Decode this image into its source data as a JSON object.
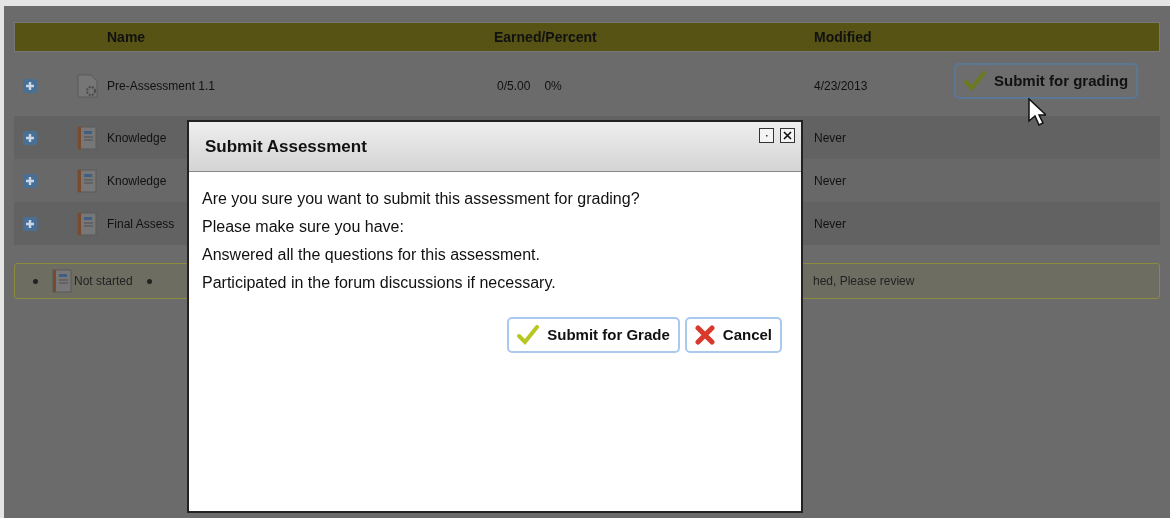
{
  "table": {
    "columns": [
      "Name",
      "Earned/Percent",
      "Modified"
    ],
    "rows": [
      {
        "kind": "settings-doc",
        "name": "Pre-Assessment 1.1",
        "earned": "0/5.00",
        "percent": "0%",
        "modified": "4/23/2013",
        "action": "Submit for grading"
      },
      {
        "kind": "notebook",
        "name": "Knowledge",
        "modified": "Never"
      },
      {
        "kind": "notebook",
        "name": "Knowledge",
        "modified": "Never"
      },
      {
        "kind": "notebook",
        "name": "Final Assess",
        "modified": "Never"
      }
    ]
  },
  "legend": {
    "items": [
      "Not started"
    ],
    "trailing": "hed, Please review"
  },
  "dialog": {
    "title": "Submit Assessment",
    "lines": [
      "Are you sure you want to submit this assessment for grading?",
      "Please make sure you have:",
      "Answered all the questions for this assessment.",
      "Participated in the forum discussions if necessary."
    ],
    "buttons": [
      {
        "kind": "confirm",
        "label": "Submit for Grade"
      },
      {
        "kind": "cancel",
        "label": "Cancel"
      }
    ]
  }
}
